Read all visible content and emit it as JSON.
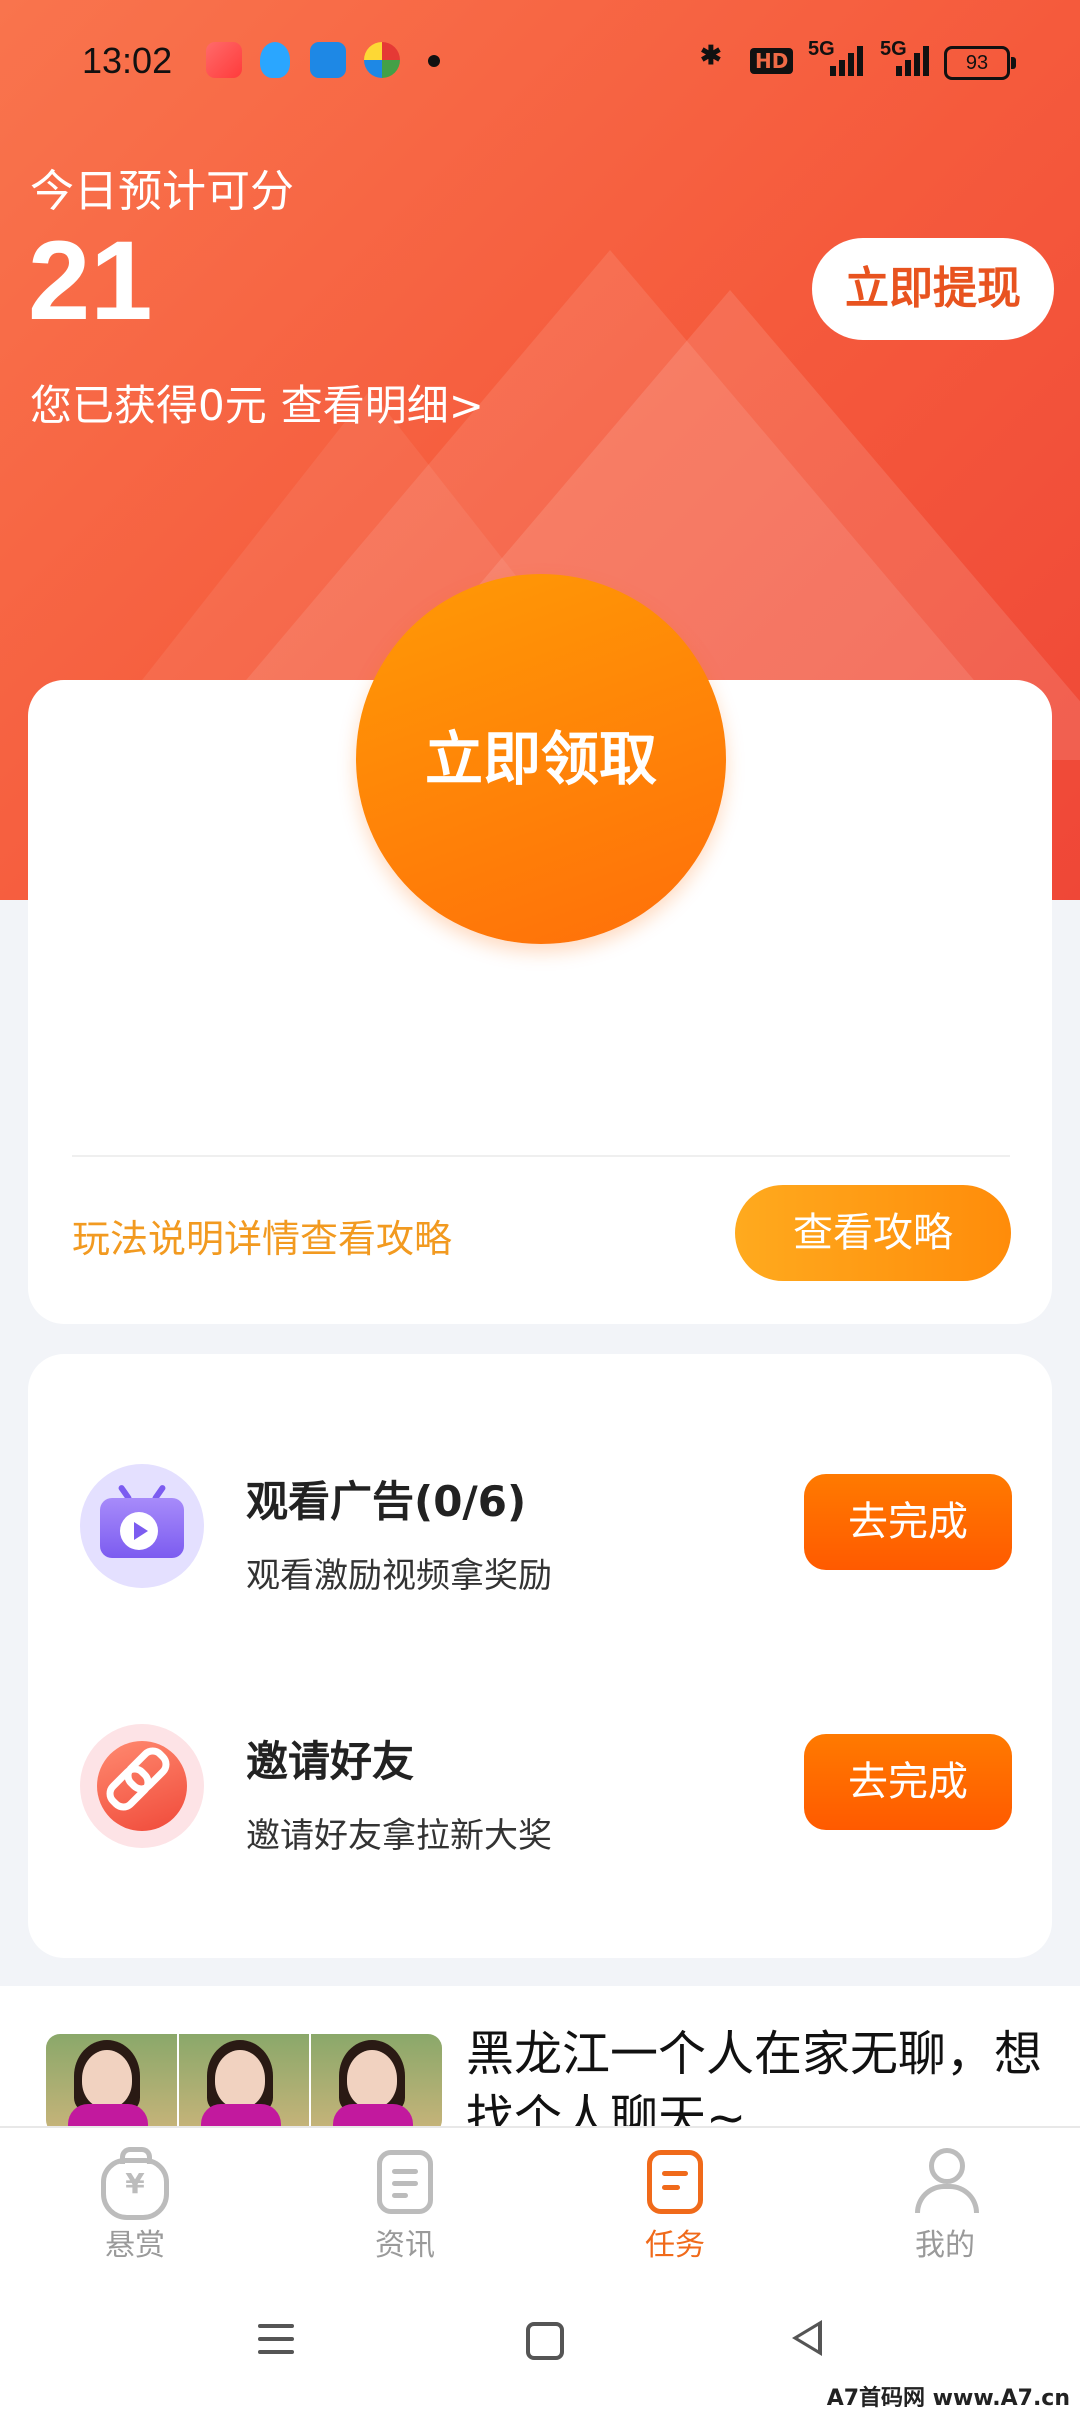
{
  "status_bar": {
    "time": "13:02",
    "network_hd": "HD",
    "network_1": "5G",
    "network_2": "5G",
    "battery": "93"
  },
  "header": {
    "estimate_label": "今日预计可分",
    "estimate_value": "21",
    "earned_text": "您已获得0元",
    "detail_link": "查看明细>",
    "withdraw_button": "立即提现"
  },
  "claim_card": {
    "claim_button": "立即领取",
    "guide_text": "玩法说明详情查看攻略",
    "guide_button": "查看攻略"
  },
  "tasks": [
    {
      "title": "观看广告(0/6)",
      "desc": "观看激励视频拿奖励",
      "button": "去完成",
      "icon": "tv-play-icon"
    },
    {
      "title": "邀请好友",
      "desc": "邀请好友拿拉新大奖",
      "button": "去完成",
      "icon": "link-icon"
    }
  ],
  "feed": {
    "title": "黑龙江一个人在家无聊，想找个人聊天~"
  },
  "tab_bar": {
    "items": [
      {
        "label": "悬赏",
        "icon": "money-bag-icon",
        "active": false
      },
      {
        "label": "资讯",
        "icon": "news-icon",
        "active": false
      },
      {
        "label": "任务",
        "icon": "task-icon",
        "active": true
      },
      {
        "label": "我的",
        "icon": "user-icon",
        "active": false
      }
    ]
  },
  "colors": {
    "hero_start": "#f9744d",
    "hero_end": "#ef4737",
    "accent_orange": "#ff7a00",
    "guide_text": "#f29a20",
    "tab_active": "#f06a1a"
  },
  "watermark": "A7首码网 www.A7.cn"
}
